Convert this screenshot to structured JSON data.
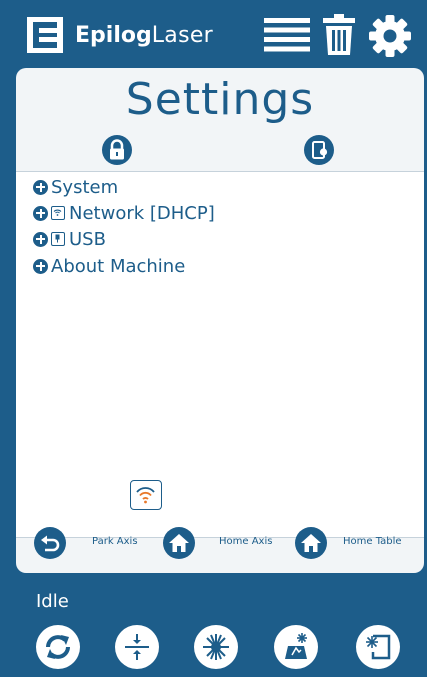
{
  "header": {
    "brand_bold": "Epilog",
    "brand_light": "Laser",
    "icons": [
      "queue-list-icon",
      "trash-icon",
      "gear-icon"
    ]
  },
  "settings": {
    "title": "Settings",
    "tabs": [
      "lock-icon",
      "device-export-icon"
    ]
  },
  "tree": {
    "items": [
      {
        "label": "System",
        "icon": "plus-circle-icon"
      },
      {
        "label": "Network [DHCP]",
        "icon": "network-icon"
      },
      {
        "label": "USB",
        "icon": "usb-icon"
      },
      {
        "label": "About Machine",
        "icon": "plus-circle-icon"
      }
    ]
  },
  "actions": {
    "park_axis": "Park Axis",
    "home_axis": "Home Axis",
    "home_table": "Home Table"
  },
  "footer": {
    "status": "Idle",
    "buttons": [
      "refresh-icon",
      "focus-icon",
      "laser-icon",
      "job-icon",
      "frame-icon"
    ]
  },
  "colors": {
    "primary": "#1d5d8a",
    "panel": "#f2f5f7",
    "wifi_accent": "#e8782a"
  }
}
